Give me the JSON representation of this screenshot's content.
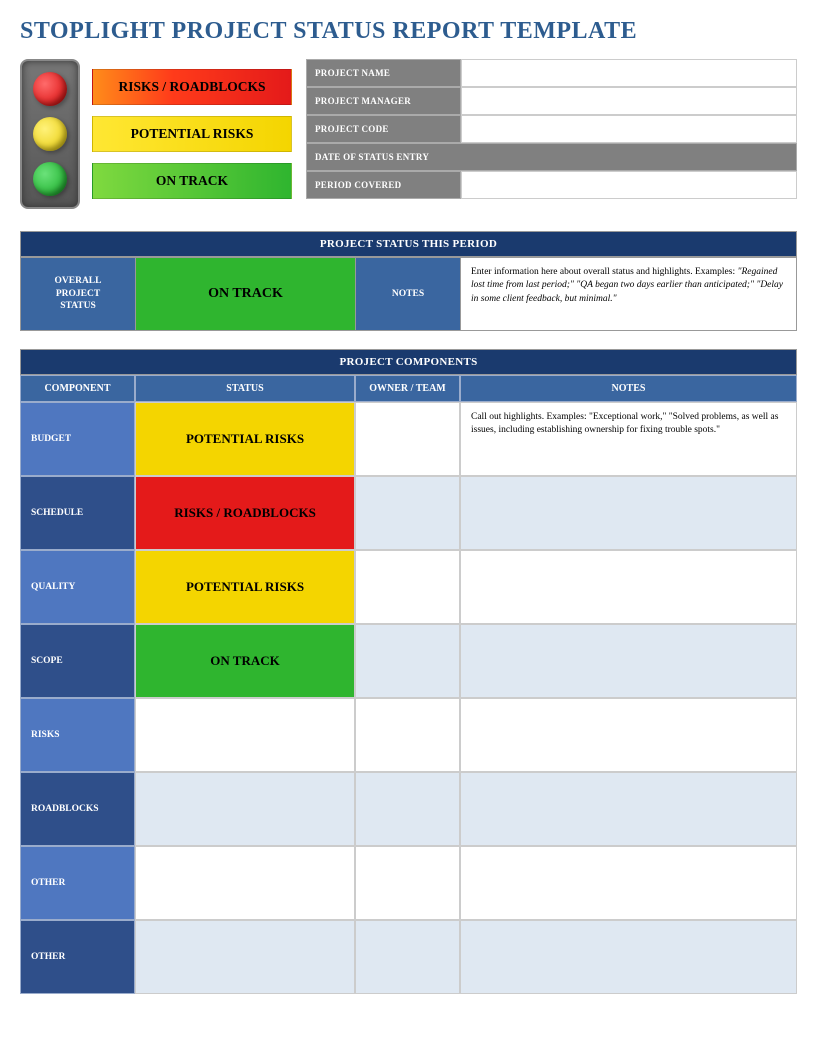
{
  "title": "STOPLIGHT PROJECT STATUS REPORT TEMPLATE",
  "legend": {
    "red": "RISKS / ROADBLOCKS",
    "yellow": "POTENTIAL RISKS",
    "green": "ON TRACK"
  },
  "meta": {
    "project_name_label": "PROJECT NAME",
    "project_name_value": "",
    "project_manager_label": "PROJECT MANAGER",
    "project_manager_value": "",
    "project_code_label": "PROJECT CODE",
    "project_code_value": "",
    "date_entry_label": "DATE OF STATUS ENTRY",
    "period_covered_label": "PERIOD COVERED",
    "period_covered_value": ""
  },
  "status_section": {
    "header": "PROJECT STATUS THIS PERIOD",
    "overall_label_line1": "OVERALL",
    "overall_label_line2": "PROJECT",
    "overall_label_line3": "STATUS",
    "overall_status": "ON TRACK",
    "notes_label": "NOTES",
    "notes_text": "Enter information here about overall status and highlights. Examples: ",
    "notes_italic": "\"Regained lost time from last period;\" \"QA began two days earlier than anticipated;\" \"Delay in some client feedback, but minimal.\""
  },
  "components_section": {
    "header": "PROJECT COMPONENTS",
    "col_component": "COMPONENT",
    "col_status": "STATUS",
    "col_owner": "OWNER / TEAM",
    "col_notes": "NOTES",
    "rows": [
      {
        "label": "BUDGET",
        "status": "POTENTIAL RISKS",
        "status_color": "yellow",
        "owner": "",
        "notes": "Call out highlights. Examples: \"Exceptional work,\" \"Solved problems, as well as issues, including establishing ownership for fixing trouble spots.\"",
        "shade": "white",
        "label_shade": "light"
      },
      {
        "label": "SCHEDULE",
        "status": "RISKS / ROADBLOCKS",
        "status_color": "red",
        "owner": "",
        "notes": "",
        "shade": "light",
        "label_shade": "dark"
      },
      {
        "label": "QUALITY",
        "status": "POTENTIAL RISKS",
        "status_color": "yellow",
        "owner": "",
        "notes": "",
        "shade": "white",
        "label_shade": "light"
      },
      {
        "label": "SCOPE",
        "status": "ON TRACK",
        "status_color": "green",
        "owner": "",
        "notes": "",
        "shade": "light",
        "label_shade": "dark"
      },
      {
        "label": "RISKS",
        "status": "",
        "status_color": "",
        "owner": "",
        "notes": "",
        "shade": "white",
        "label_shade": "light"
      },
      {
        "label": "ROADBLOCKS",
        "status": "",
        "status_color": "",
        "owner": "",
        "notes": "",
        "shade": "light",
        "label_shade": "dark"
      },
      {
        "label": "OTHER",
        "status": "",
        "status_color": "",
        "owner": "",
        "notes": "",
        "shade": "white",
        "label_shade": "light"
      },
      {
        "label": "OTHER",
        "status": "",
        "status_color": "",
        "owner": "",
        "notes": "",
        "shade": "light",
        "label_shade": "dark"
      }
    ]
  }
}
